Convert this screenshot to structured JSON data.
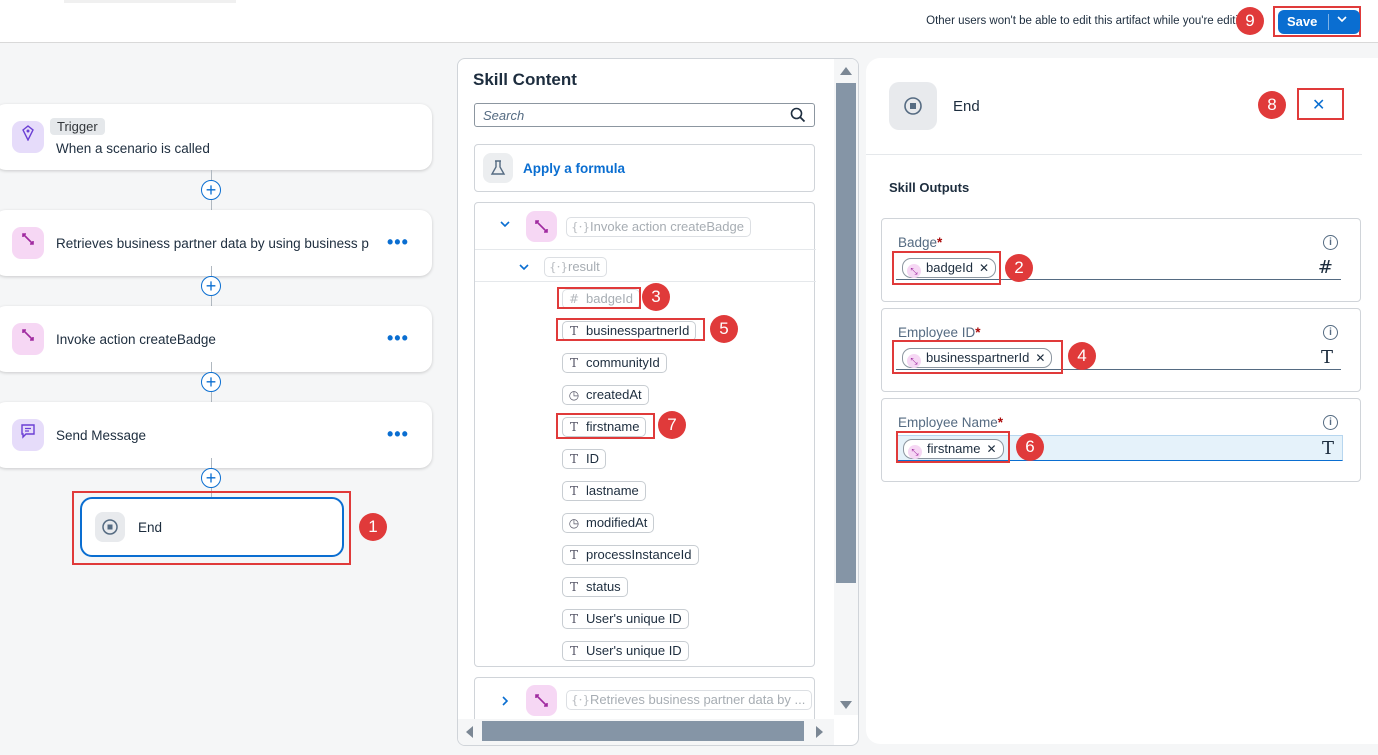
{
  "header": {
    "lock_message": "Other users won't be able to edit this artifact while you're editi",
    "save_label": "Save"
  },
  "flow": {
    "trigger_badge": "Trigger",
    "trigger_text": "When a scenario is called",
    "steps": [
      {
        "label": "Retrieves business partner data by using business p"
      },
      {
        "label": "Invoke action createBadge"
      },
      {
        "label": "Send Message"
      }
    ],
    "end_label": "End",
    "more_glyph": "•••",
    "plus_glyph": "+"
  },
  "skill_content": {
    "title": "Skill Content",
    "search_placeholder": "Search",
    "formula_label": "Apply a formula",
    "group_label": "Invoke action createBadge",
    "result_label": "result",
    "fields": [
      {
        "type": "#",
        "label": "badgeId"
      },
      {
        "type": "T",
        "label": "businesspartnerId"
      },
      {
        "type": "T",
        "label": "communityId"
      },
      {
        "type": "◷",
        "label": "createdAt"
      },
      {
        "type": "T",
        "label": "firstname"
      },
      {
        "type": "T",
        "label": "ID"
      },
      {
        "type": "T",
        "label": "lastname"
      },
      {
        "type": "◷",
        "label": "modifiedAt"
      },
      {
        "type": "T",
        "label": "processInstanceId"
      },
      {
        "type": "T",
        "label": "status"
      },
      {
        "type": "T",
        "label": "User's unique ID"
      },
      {
        "type": "T",
        "label": "User's unique ID"
      }
    ],
    "group2_label": "Retrieves business partner data by ..."
  },
  "end_panel": {
    "title": "End",
    "close_glyph": "✕",
    "section_title": "Skill Outputs",
    "outputs": [
      {
        "label": "Badge",
        "required": "*",
        "token": "badgeId",
        "type_glyph": "#"
      },
      {
        "label": "Employee ID",
        "required": "*",
        "token": "businesspartnerId",
        "type_glyph": "T"
      },
      {
        "label": "Employee Name",
        "required": "*",
        "token": "firstname",
        "type_glyph": "T"
      }
    ]
  },
  "callouts": [
    "1",
    "2",
    "3",
    "4",
    "5",
    "6",
    "7",
    "8",
    "9"
  ],
  "colors": {
    "accent": "#0a6ed1",
    "callout": "#e03a3a",
    "step_icon_bg": "#f6d7f4"
  }
}
